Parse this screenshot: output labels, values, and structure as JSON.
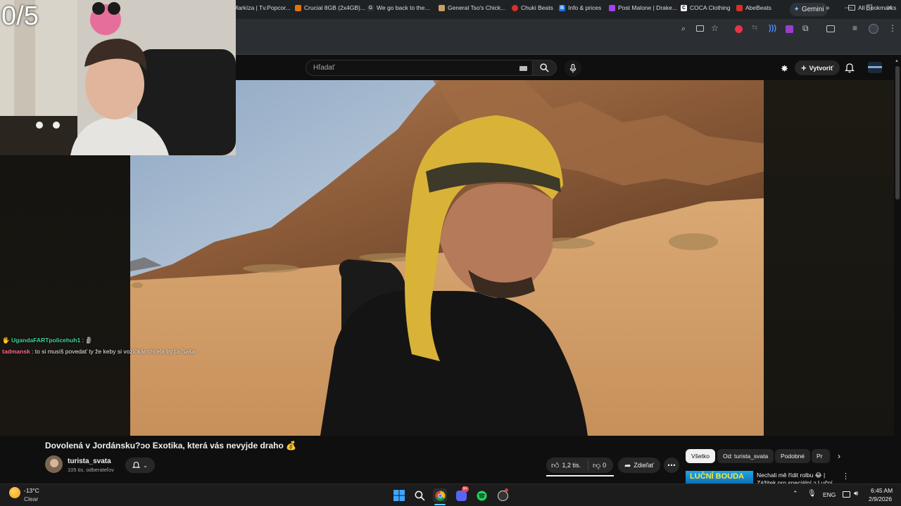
{
  "stream": {
    "counter": "0/5"
  },
  "browser": {
    "gemini_label": "Gemini",
    "bookmarks": [
      {
        "label": "Markíza | Tv.Popcor...",
        "color": "#e05a2b"
      },
      {
        "label": "Crucial 8GB (2x4GB)...",
        "color": "#e8710a"
      },
      {
        "label": "We go back to the...",
        "color": "#34a853"
      },
      {
        "label": "General Tso's Chick...",
        "color": "#c8a165"
      },
      {
        "label": "Chuki Beats",
        "color": "#d93025"
      },
      {
        "label": "Info & prices",
        "color": "#1a73e8"
      },
      {
        "label": "Post Malone | Drake...",
        "color": "#a142f4"
      },
      {
        "label": "COCA Clothing",
        "color": "#202124"
      },
      {
        "label": "AbeBeats",
        "color": "#d93025"
      }
    ],
    "all_bookmarks": "All Bookmarks"
  },
  "youtube": {
    "search_placeholder": "Hľadať",
    "create_label": "Vytvoriť",
    "video_title": "Dovolená v Jordánsku?ↄo Exotika, která vás nevyjde draho 💰",
    "channel_name": "turista_svata",
    "channel_subs": "105 tis. odberateľov",
    "likes": "1,2 tis.",
    "dislikes": "0",
    "share_label": "Zdieľať",
    "chips": [
      "Všetko",
      "Od: turista_svata",
      "Podobné",
      "Pr"
    ],
    "recommended": {
      "thumb_text": "LUČNÍ BOUDA",
      "title": "Nechali mě řídit rolbu 😂 | Zážitek pro speciální ↄ Luční"
    }
  },
  "chat": [
    {
      "user": "UgandaFARTpolicehuh1",
      "user_color": "#3fd39a",
      "message": "🗿"
    },
    {
      "user": "tadmansk",
      "user_color": "#ff6b8a",
      "message": "to si musíš povedať ty že keby si vozíčkár chcela by ťa Saša"
    }
  ],
  "taskbar": {
    "weather_temp": "-13°C",
    "weather_desc": "Clear",
    "lang": "ENG",
    "time": "6:45 AM",
    "date": "2/9/2026",
    "discord_badge": "9+"
  }
}
